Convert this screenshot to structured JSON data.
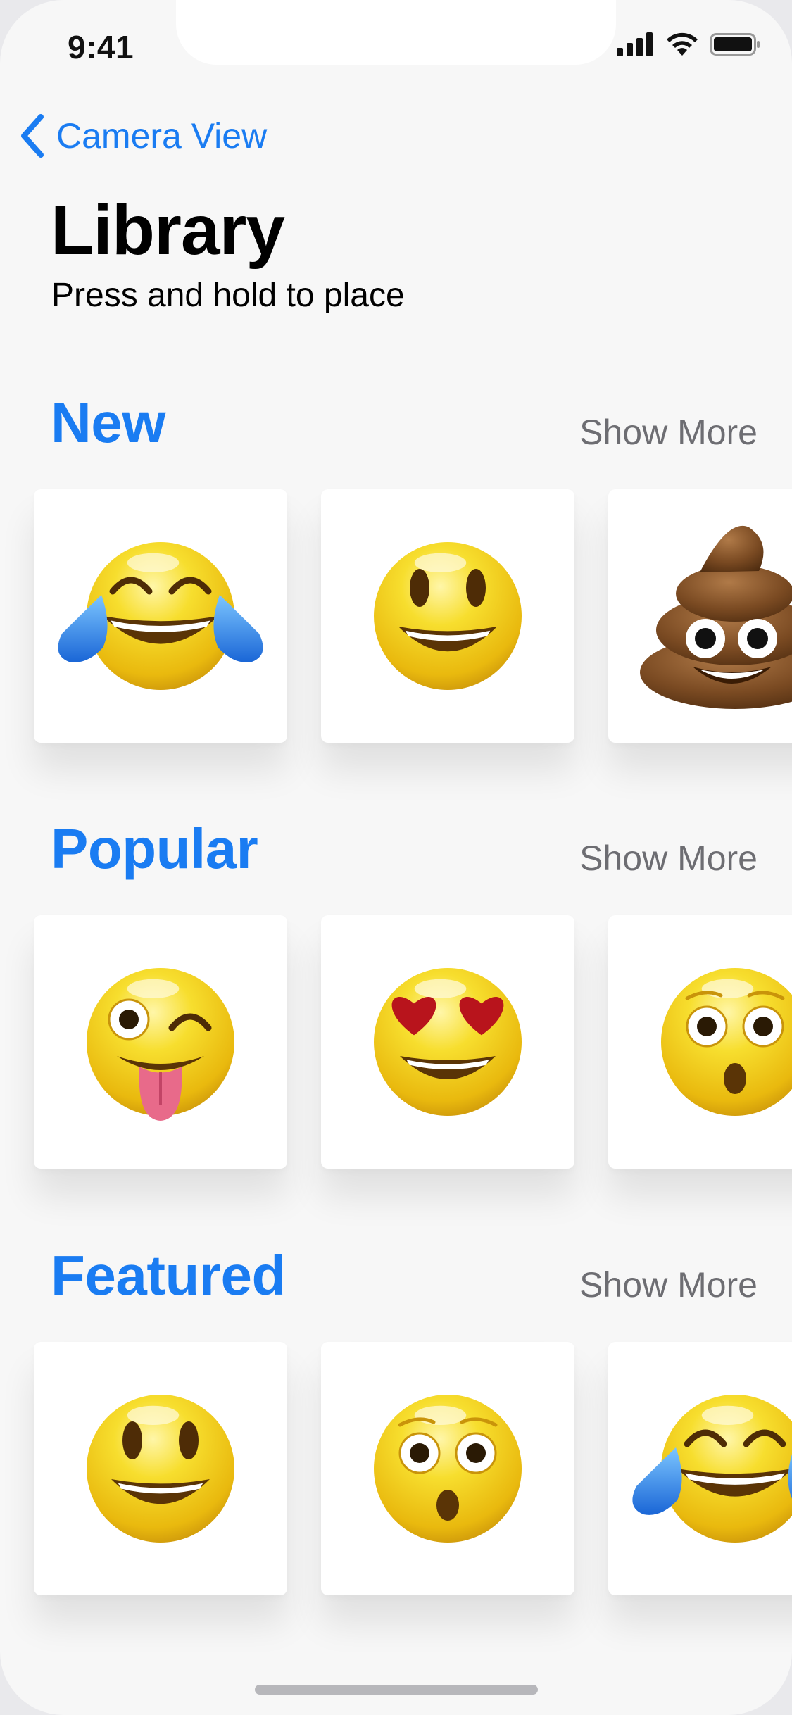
{
  "status_bar": {
    "time": "9:41",
    "icons": [
      "cellular-signal-icon",
      "wifi-icon",
      "battery-icon"
    ]
  },
  "nav": {
    "back_label": "Camera View",
    "back_icon": "chevron-left-icon"
  },
  "header": {
    "title": "Library",
    "subtitle": "Press and hold to place"
  },
  "colors": {
    "accent": "#1a7cf2",
    "secondary_text": "#6d6d72",
    "background": "#f7f7f7",
    "card": "#ffffff"
  },
  "sections": [
    {
      "title": "New",
      "show_more": "Show More",
      "items": [
        "tears-of-joy-emoji",
        "grinning-emoji",
        "pile-of-poo-emoji"
      ]
    },
    {
      "title": "Popular",
      "show_more": "Show More",
      "items": [
        "winking-tongue-emoji",
        "heart-eyes-emoji",
        "astonished-emoji"
      ]
    },
    {
      "title": "Featured",
      "show_more": "Show More",
      "items": [
        "grinning-emoji",
        "astonished-emoji",
        "tears-of-joy-emoji"
      ]
    }
  ]
}
